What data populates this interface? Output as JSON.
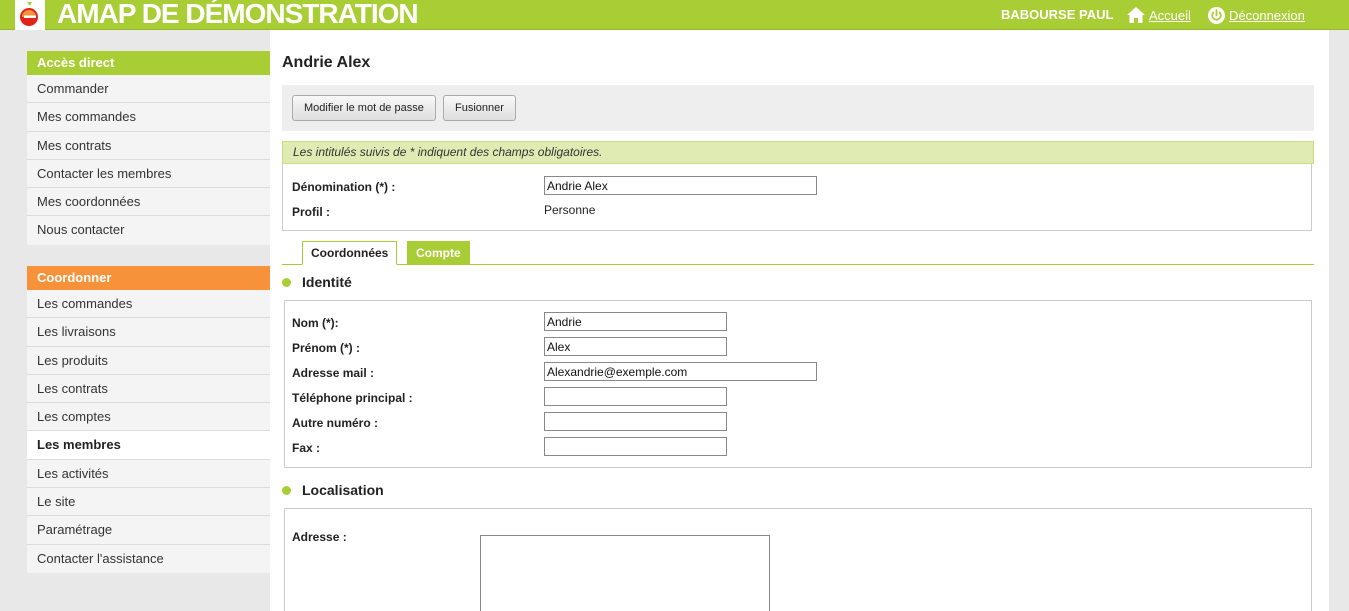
{
  "header": {
    "title": "AMAP DE DÉMONSTRATION",
    "user_name": "BABOURSE PAUL",
    "home_label": "Accueil",
    "logout_label": "Déconnexion",
    "accent_color": "#a9cd34"
  },
  "sidebar": {
    "direct_access": {
      "title": "Accès direct",
      "items": [
        {
          "label": "Commander"
        },
        {
          "label": "Mes commandes"
        },
        {
          "label": "Mes contrats"
        },
        {
          "label": "Contacter les membres"
        },
        {
          "label": "Mes coordonnées"
        },
        {
          "label": "Nous contacter"
        }
      ]
    },
    "coordinate": {
      "title": "Coordonner",
      "color": "#f7923a",
      "items": [
        {
          "label": "Les commandes"
        },
        {
          "label": "Les livraisons"
        },
        {
          "label": "Les produits"
        },
        {
          "label": "Les contrats"
        },
        {
          "label": "Les comptes"
        },
        {
          "label": "Les membres",
          "active": true
        },
        {
          "label": "Les activités"
        },
        {
          "label": "Le site"
        },
        {
          "label": "Paramétrage"
        },
        {
          "label": "Contacter l'assistance"
        }
      ]
    }
  },
  "main": {
    "page_title": "Andrie Alex",
    "buttons": {
      "change_password": "Modifier le mot de passe",
      "merge": "Fusionner"
    },
    "notice": "Les intitulés suivis de * indiquent des champs obligatoires.",
    "top_fields": {
      "denomination_label": "Dénomination (*) :",
      "denomination_value": "Andrie Alex",
      "profile_label": "Profil :",
      "profile_value": "Personne"
    },
    "tabs": [
      {
        "label": "Coordonnées",
        "active": true
      },
      {
        "label": "Compte",
        "active": false
      }
    ],
    "identity": {
      "title": "Identité",
      "nom_label": "Nom (*):",
      "nom_value": "Andrie",
      "prenom_label": "Prénom (*) :",
      "prenom_value": "Alex",
      "email_label": "Adresse mail :",
      "email_value": "Alexandrie@exemple.com",
      "phone_label": "Téléphone principal :",
      "phone_value": "",
      "other_label": "Autre numéro :",
      "other_value": "",
      "fax_label": "Fax :",
      "fax_value": ""
    },
    "location": {
      "title": "Localisation",
      "address_label": "Adresse :",
      "address_value": ""
    }
  }
}
